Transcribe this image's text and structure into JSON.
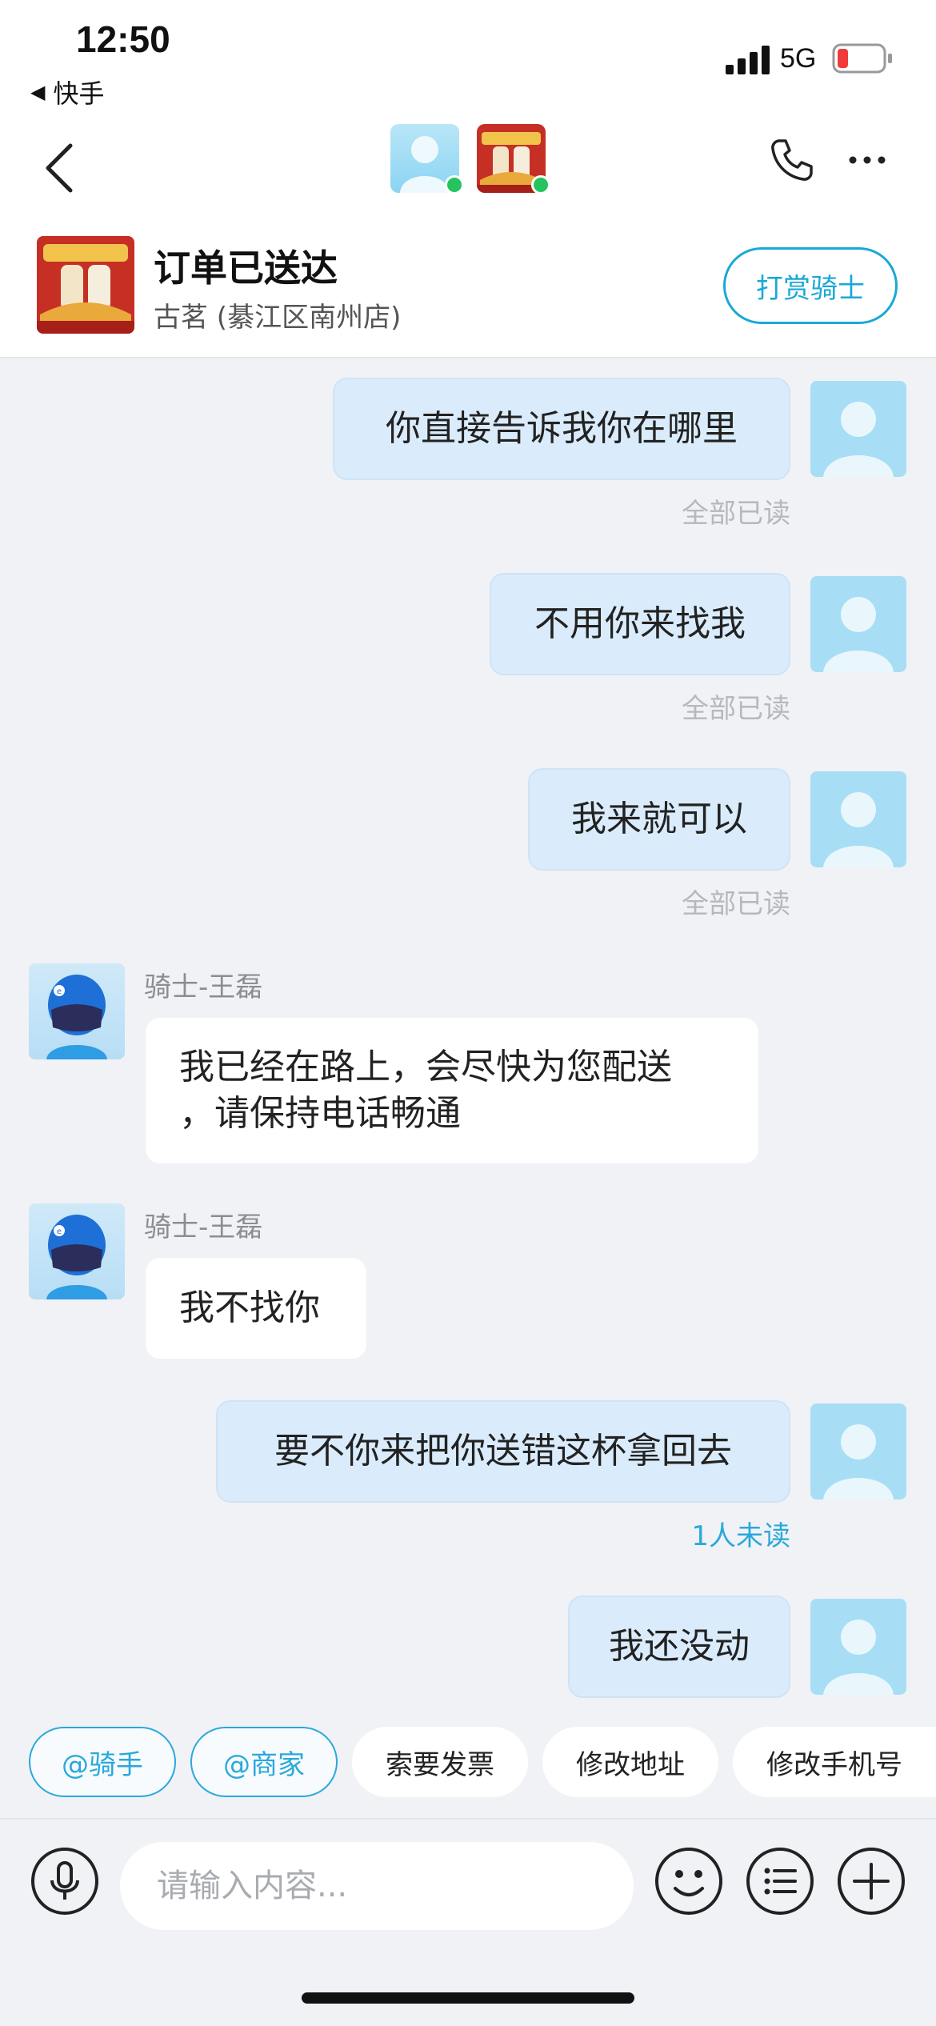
{
  "status_bar": {
    "time": "12:50",
    "back_app": "快手",
    "network": "5G",
    "battery_color": "#ef3b3b"
  },
  "nav": {
    "back_icon": "chevron-left-icon",
    "user_avatar_icon": "user-avatar-icon",
    "shop_avatar_icon": "shop-logo-icon",
    "online_color": "#25c45e"
  },
  "order": {
    "title": "订单已送达",
    "shop": "古茗 (綦江区南州店)",
    "tip_button": "打赏骑士",
    "accent": "#1aa8d6"
  },
  "messages": [
    {
      "side": "out",
      "text": "你直接告诉我你在哪里",
      "status": "全部已读"
    },
    {
      "side": "out",
      "text": "不用你来找我",
      "status": "全部已读"
    },
    {
      "side": "out",
      "text": "我来就可以",
      "status": "全部已读"
    },
    {
      "side": "in",
      "sender": "骑士-王磊",
      "line1": "我已经在路上，会尽快为您配送",
      "line2": "，请保持电话畅通"
    },
    {
      "side": "in",
      "sender": "骑士-王磊",
      "text": "我不找你"
    },
    {
      "side": "out",
      "text": "要不你来把你送错这杯拿回去",
      "status": "1人未读"
    },
    {
      "side": "out",
      "text": "我还没动"
    }
  ],
  "quick_actions": [
    "@骑手",
    "@商家",
    "索要发票",
    "修改地址",
    "修改手机号"
  ],
  "input": {
    "placeholder": "请输入内容..."
  }
}
